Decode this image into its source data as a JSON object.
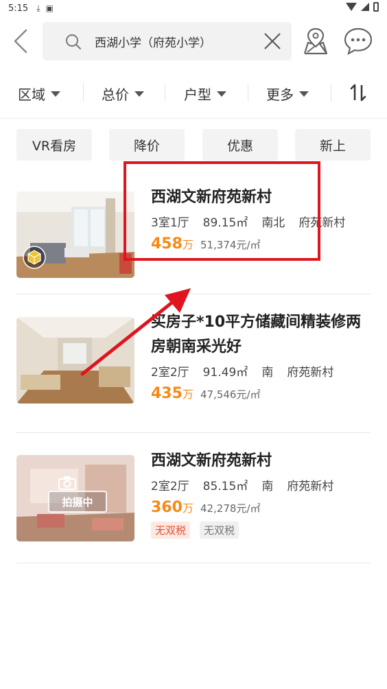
{
  "status_bar": {
    "time": "5:15"
  },
  "search": {
    "query": "西湖小学（府苑小学）"
  },
  "filters": [
    {
      "label": "区域"
    },
    {
      "label": "总价"
    },
    {
      "label": "户型"
    },
    {
      "label": "更多"
    }
  ],
  "sort": {
    "icon": "sort-toggle-icon"
  },
  "tags": [
    "VR看房",
    "降价",
    "优惠",
    "新上"
  ],
  "listings": [
    {
      "title": "西湖文新府苑新村",
      "layout": "3室1厅",
      "area": "89.15㎡",
      "orientation": "南北",
      "community": "府苑新村",
      "price": "458",
      "price_unit": "万",
      "unit_price": "51,374元/㎡",
      "badge": "vr-cube-icon"
    },
    {
      "title": "买房子*10平方储藏间精装修两房朝南采光好",
      "layout": "2室2厅",
      "area": "91.49㎡",
      "orientation": "南",
      "community": "府苑新村",
      "price": "435",
      "price_unit": "万",
      "unit_price": "47,546元/㎡"
    },
    {
      "title": "西湖文新府苑新村",
      "layout": "2室2厅",
      "area": "85.15㎡",
      "orientation": "南",
      "community": "府苑新村",
      "price": "360",
      "price_unit": "万",
      "unit_price": "42,278元/㎡",
      "thumb_overlay": "拍摄中",
      "badges": [
        "无双税",
        "无双税"
      ]
    }
  ],
  "colors": {
    "accent_price": "#f68a16",
    "highlight": "#e0141e",
    "badge_red_text": "#e0532f"
  }
}
